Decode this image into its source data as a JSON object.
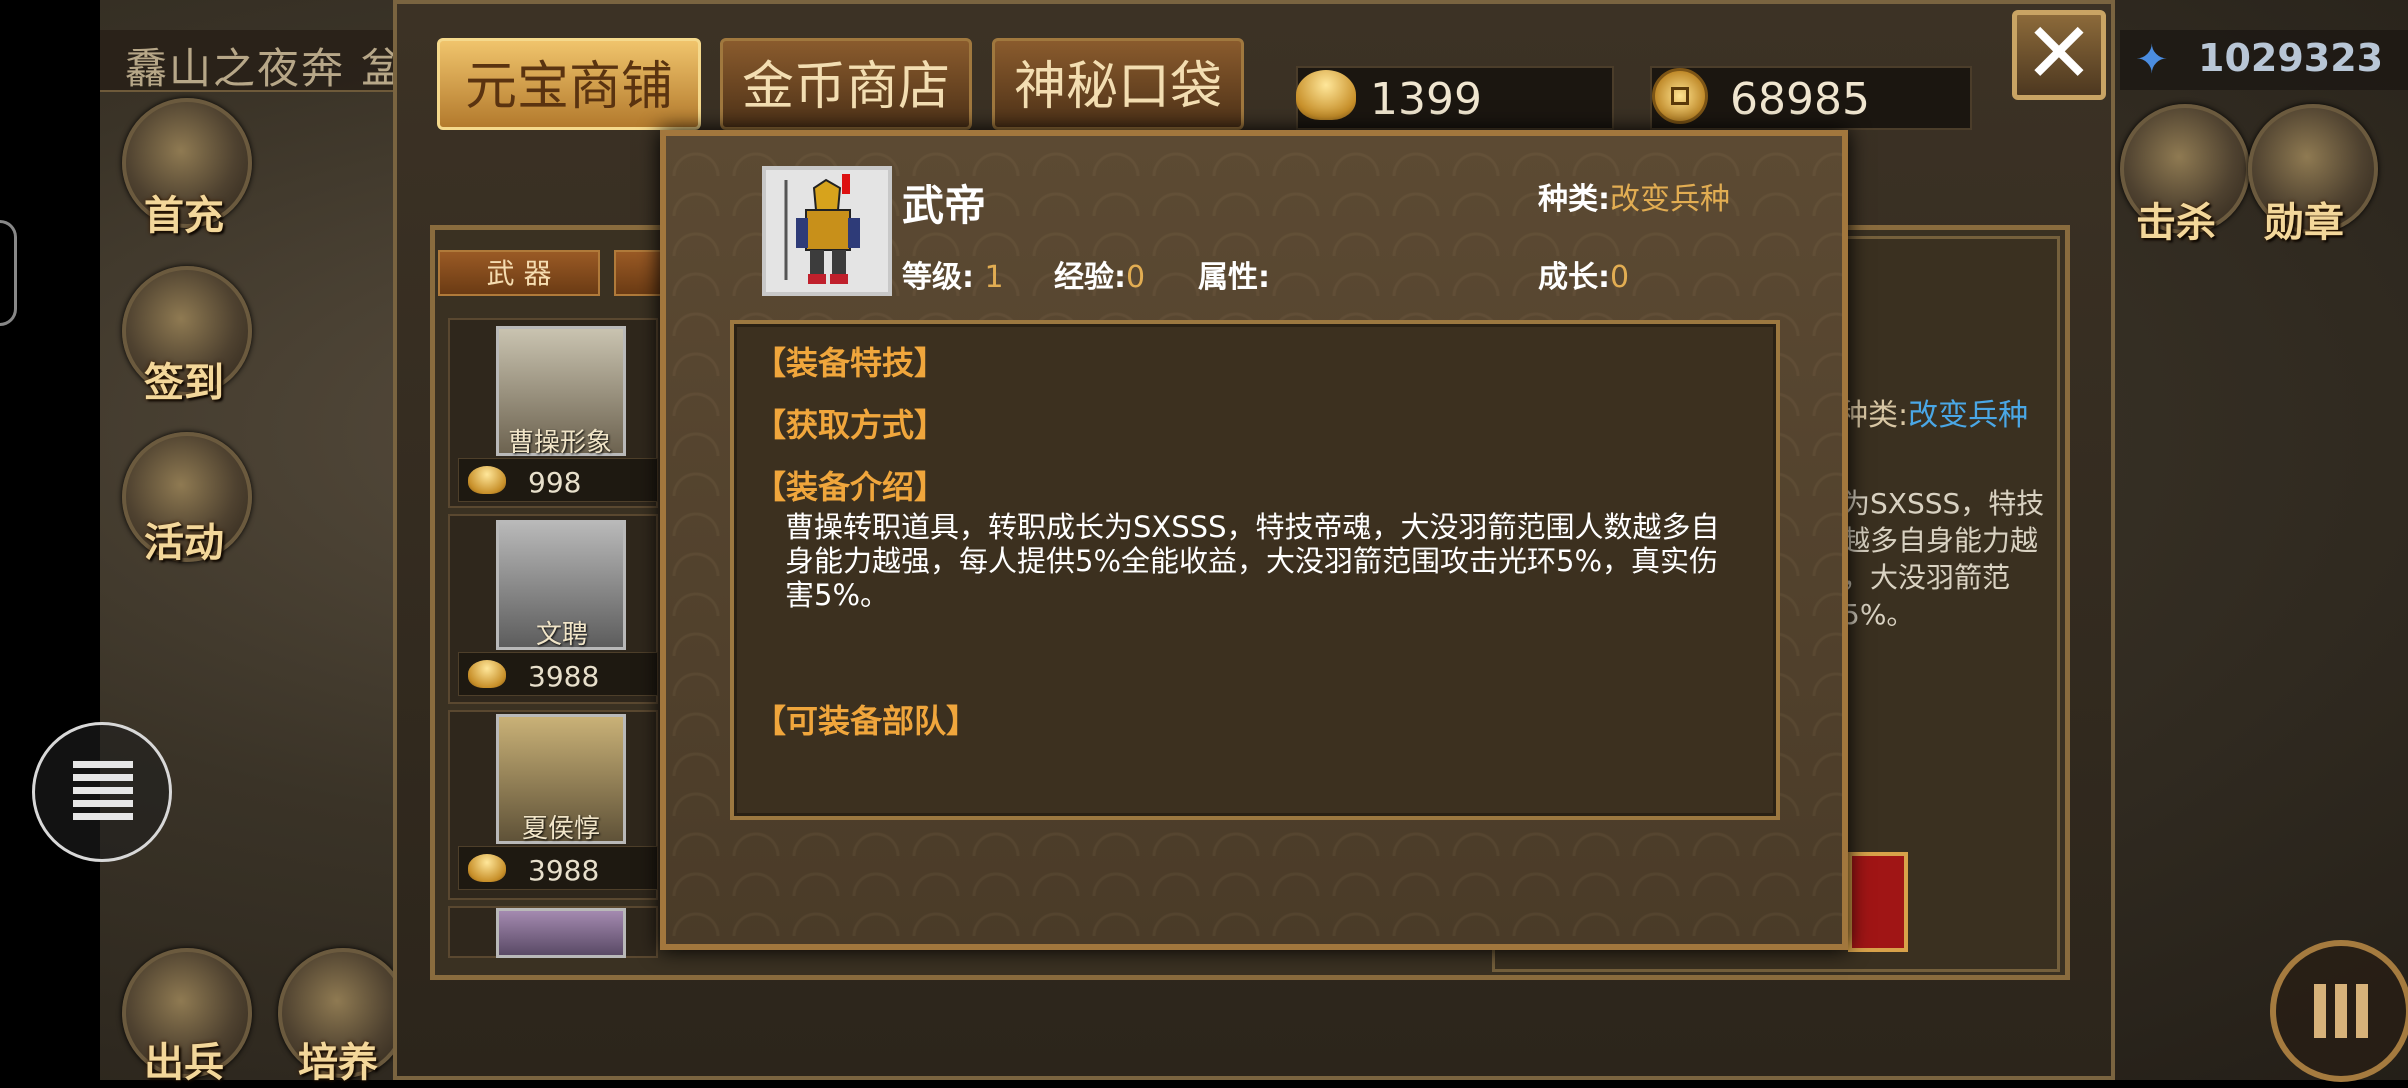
{
  "background": {
    "map_title": "馫山之夜奔 㿽",
    "left_icons": [
      {
        "label": "首充"
      },
      {
        "label": "签到"
      },
      {
        "label": "活动"
      },
      {
        "label": "出兵"
      },
      {
        "label": "培养"
      }
    ],
    "right_icons": [
      {
        "label": "击杀"
      },
      {
        "label": "勋章"
      }
    ],
    "blue_currency": "1029323"
  },
  "shop": {
    "tabs": [
      {
        "label": "元宝商铺",
        "active": true
      },
      {
        "label": "金币商店",
        "active": false
      },
      {
        "label": "神秘口袋",
        "active": false
      }
    ],
    "ingot_balance": "1399",
    "gold_balance": "68985",
    "close_icon": "close-icon",
    "category_tab": "武 器",
    "items": [
      {
        "name": "曹操形象",
        "price": "998"
      },
      {
        "name": "文聘",
        "price": "3988"
      },
      {
        "name": "夏侯惇",
        "price": "3988"
      }
    ],
    "right_panel": {
      "type_label": "种类:",
      "type_value": "改变兵种",
      "desc_lines": [
        "为SXSSS，特技",
        "越多自身能力越",
        "，大没羽箭范",
        "5%。"
      ]
    }
  },
  "detail": {
    "name": "武帝",
    "type_label": "种类:",
    "type_value": "改变兵种",
    "level_label": "等级:",
    "level_value": "1",
    "exp_label": "经验:",
    "exp_value": "0",
    "attr_label": "属性:",
    "attr_value": "",
    "growth_label": "成长:",
    "growth_value": "0",
    "sections": {
      "skill": "【装备特技】",
      "obtain": "【获取方式】",
      "intro": "【装备介绍】",
      "units": "【可装备部队】"
    },
    "intro_text": "曹操转职道具，转职成长为SXSSS，特技帝魂，大没羽箭范围人数越多自身能力越强，每人提供5%全能收益，大没羽箭范围攻击光环5%，真实伤害5%。"
  }
}
